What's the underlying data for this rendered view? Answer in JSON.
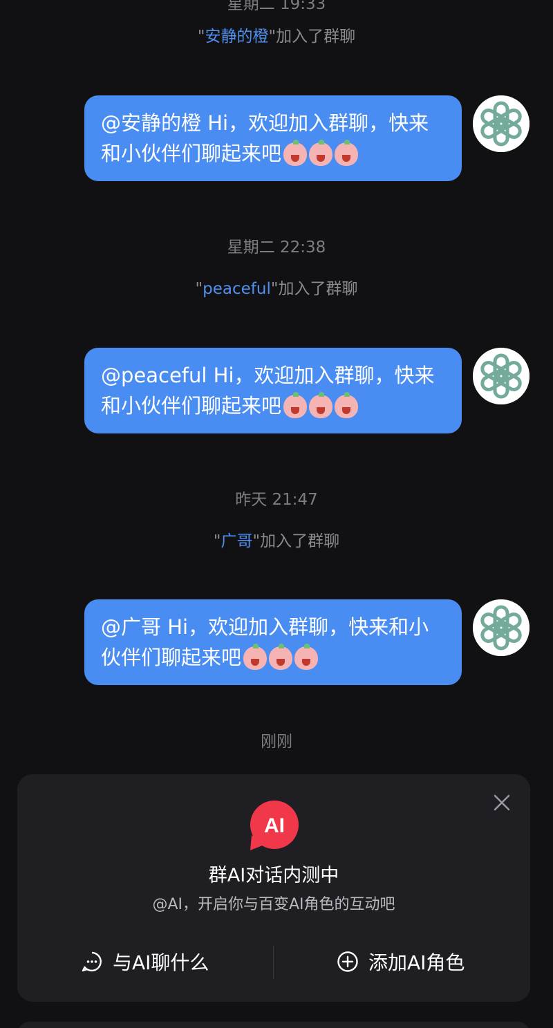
{
  "top_timestamp_partial": "星期二 19:33",
  "messages": [
    {
      "join_user": "安静的橙",
      "join_suffix": "加入了群聊",
      "bubble_text": "@安静的橙 Hi，欢迎加入群聊，快来和小伙伴们聊起来吧"
    },
    {
      "timestamp": "星期二 22:38",
      "join_user": "peaceful",
      "join_suffix": "加入了群聊",
      "bubble_text": "@peaceful Hi，欢迎加入群聊，快来和小伙伴们聊起来吧"
    },
    {
      "timestamp": "昨天 21:47",
      "join_user": "广哥",
      "join_suffix": "加入了群聊",
      "bubble_text": "@广哥 Hi，欢迎加入群聊，快来和小伙伴们聊起来吧"
    }
  ],
  "last_timestamp": "刚刚",
  "ai_card": {
    "logo_text": "AI",
    "title": "群AI对话内测中",
    "subtitle": "@AI，开启你与百变AI角色的互动吧",
    "action_chat": "与AI聊什么",
    "action_add": "添加AI角色"
  },
  "colors": {
    "background": "#111113",
    "bubble": "#4a8df2",
    "username_link": "#4f8ff0",
    "card": "#1f1f23",
    "ai_logo": "#f0384a",
    "avatar_logo": "#74aa9c"
  },
  "icons": {
    "avatar": "openai-logo-icon",
    "emoji": "pink-pig-face-emoji",
    "close": "close-icon",
    "chat": "chat-bubble-icon",
    "add": "plus-circle-icon"
  }
}
